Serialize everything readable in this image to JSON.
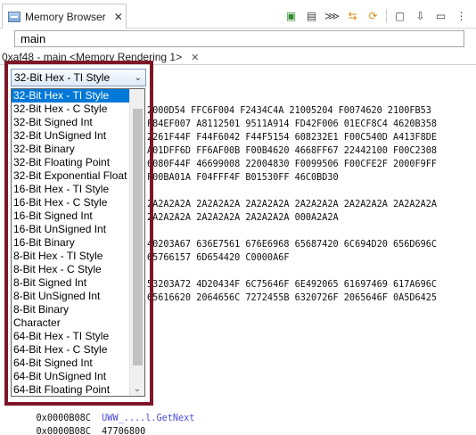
{
  "view": {
    "title": "Memory Browser",
    "close_glyph": "✕"
  },
  "toolbar": {
    "icons": [
      "chip-icon",
      "memory-icon",
      "pipeline-icon",
      "link-icon",
      "refresh-icon",
      "new-tab-icon",
      "import-icon",
      "collapse-icon",
      "view-menu-icon"
    ]
  },
  "expression": {
    "value": "main"
  },
  "rendering_tab": {
    "label": "0xaf48 - main <Memory Rendering 1>",
    "close_glyph": "✕"
  },
  "format_combo": {
    "value": "32-Bit Hex - TI Style",
    "arrow_glyph": "⌄"
  },
  "format_options": [
    "32-Bit Hex - TI Style",
    "32-Bit Hex - C Style",
    "32-Bit Signed Int",
    "32-Bit UnSigned Int",
    "32-Bit Binary",
    "32-Bit Floating Point",
    "32-Bit Exponential Float",
    "16-Bit Hex - TI Style",
    "16-Bit Hex - C Style",
    "16-Bit Signed Int",
    "16-Bit UnSigned Int",
    "16-Bit Binary",
    "8-Bit Hex - TI Style",
    "8-Bit Hex - C Style",
    "8-Bit Signed Int",
    "8-Bit UnSigned Int",
    "8-Bit Binary",
    "Character",
    "64-Bit Hex - TI Style",
    "64-Bit Hex - C Style",
    "64-Bit Signed Int",
    "64-Bit UnSigned Int",
    "64-Bit Floating Point"
  ],
  "memory_lines": [
    "2000D54 FFC6F004 F2434C4A 21005204 F0074620 2100FB53",
    "F84EF007 A8112501 9511A914 FD42F006 01ECF8C4 4620B358",
    "2261F44F F44F6042 F44F5154 608232E1 F00C540D A413F8DE",
    "A01DFF6D FF6AF00B F00B4620 4668FF67 22442100 F00C2308",
    "6080F44F 46699008 22004830 F0099506 F00CFE2F 2000F9FF",
    "F00BA01A F04FFF4F B01530FF 46C0BD30",
    "2A2A2A2A 2A2A2A2A 2A2A2A2A 2A2A2A2A 2A2A2A2A 2A2A2A2A",
    "2A2A2A2A 2A2A2A2A 2A2A2A2A 000A2A2A",
    "40203A67 636E7561 676E6968 65687420 6C694D20 656D696C",
    "65766157 6D654420 C0000A6F",
    "53203A72 4D20434F 6C75646F 6E492065 61697469 617A696C",
    "65616620 2064656C 7272455B 6320726F 2065646F 0A5D6425"
  ],
  "bottom_lines": [
    {
      "address": "0x0000B08C",
      "symbol": "UWW_....l.GetNext"
    },
    {
      "address": "0x0000B08C",
      "value": "47706800"
    }
  ]
}
